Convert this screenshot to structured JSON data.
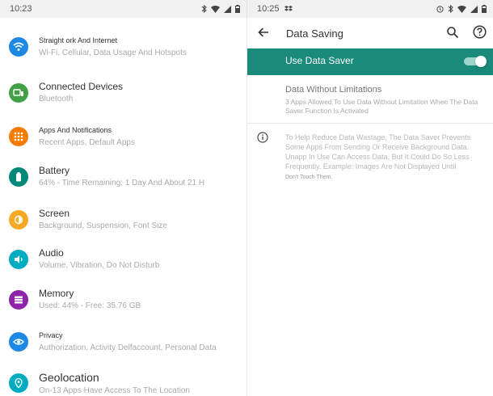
{
  "left": {
    "status": {
      "time": "10:23"
    },
    "items": [
      {
        "title": "Straight ork And Internet",
        "subtitle": "Wi-Fi, Cellular, Data Usage And Hotspots",
        "icon": "wifi-icon",
        "color": "#1e88e5"
      },
      {
        "title": "Connected Devices",
        "subtitle": "Bluetooth",
        "icon": "connected-devices-icon",
        "color": "#43a047"
      },
      {
        "title": "Apps And Notifications",
        "subtitle": "Recent Apps, Default Apps",
        "icon": "apps-grid-icon",
        "color": "#f57c00"
      },
      {
        "title": "Battery",
        "subtitle": "64% - Time Remaining: 1 Day And About 21 H",
        "icon": "battery-icon",
        "color": "#00897b"
      },
      {
        "title": "Screen",
        "subtitle": "Background, Suspension, Font Size",
        "icon": "brightness-icon",
        "color": "#f9a825"
      },
      {
        "title": "Audio",
        "subtitle": "Volume, Vibration, Do Not Disturb",
        "icon": "volume-icon",
        "color": "#00acc1"
      },
      {
        "title": "Memory",
        "subtitle": "Used: 44% - Free: 35.76 GB",
        "icon": "storage-icon",
        "color": "#8e24aa"
      },
      {
        "title": "Privacy",
        "subtitle": "Authorization, Activity Delfaccount, Personal Data",
        "icon": "privacy-eye-icon",
        "color": "#1e88e5"
      },
      {
        "title": "Geolocation",
        "subtitle": "On-13 Apps Have Access To The Location",
        "icon": "location-pin-icon",
        "color": "#00acc1"
      }
    ]
  },
  "right": {
    "status": {
      "time": "10:25"
    },
    "appbar": {
      "title": "Data Saving"
    },
    "toggle": {
      "label": "Use Data Saver",
      "on": true
    },
    "unrestricted": {
      "title": "Data Without Limitations",
      "subtitle": "3 Apps Allowed To Use Data Without Limitation When The Data Saver Function Is Activated"
    },
    "info": {
      "text": "To Help Reduce Data Wastage, The Data Saver Prevents Some Apps From Sending Or Receive Background Data. Unapp In Use Can Access Data, But It Could Do So Less Frequently. Example: Images Are Not Displayed Until",
      "tail": "Don't Touch Them."
    }
  },
  "colors": {
    "accent": "#1a8a7a"
  }
}
